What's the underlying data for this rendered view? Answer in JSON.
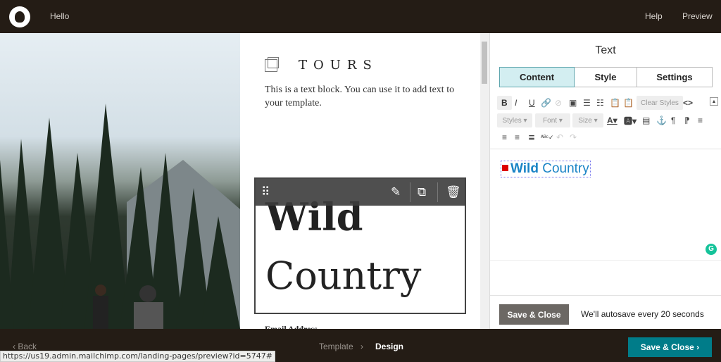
{
  "header": {
    "nav_title": "Hello",
    "help": "Help",
    "preview": "Preview"
  },
  "canvas": {
    "heading": "TOURS",
    "text_block": "This is a text block. You can use it to add text to your template.",
    "headline_bold": "Wild",
    "headline_regular": "Country",
    "email_label": "Email Address"
  },
  "panel": {
    "title": "Text",
    "tabs": [
      {
        "label": "Content",
        "active": true
      },
      {
        "label": "Style"
      },
      {
        "label": "Settings"
      }
    ],
    "toolbar": {
      "clear_styles": "Clear Styles",
      "styles": "Styles",
      "font": "Font",
      "size": "Size"
    },
    "editor": {
      "bold": "Wild",
      "regular": " Country"
    },
    "save_close": "Save & Close",
    "autosave": "We'll autosave every 20 seconds"
  },
  "footer": {
    "back": "Back",
    "steps": [
      "Template",
      "Design"
    ],
    "save_close": "Save & Close"
  },
  "status_url": "https://us19.admin.mailchimp.com/landing-pages/preview?id=5747#",
  "colors": {
    "header_bg": "#241c15",
    "accent": "#007c89",
    "editor_text": "#1a84c6"
  }
}
